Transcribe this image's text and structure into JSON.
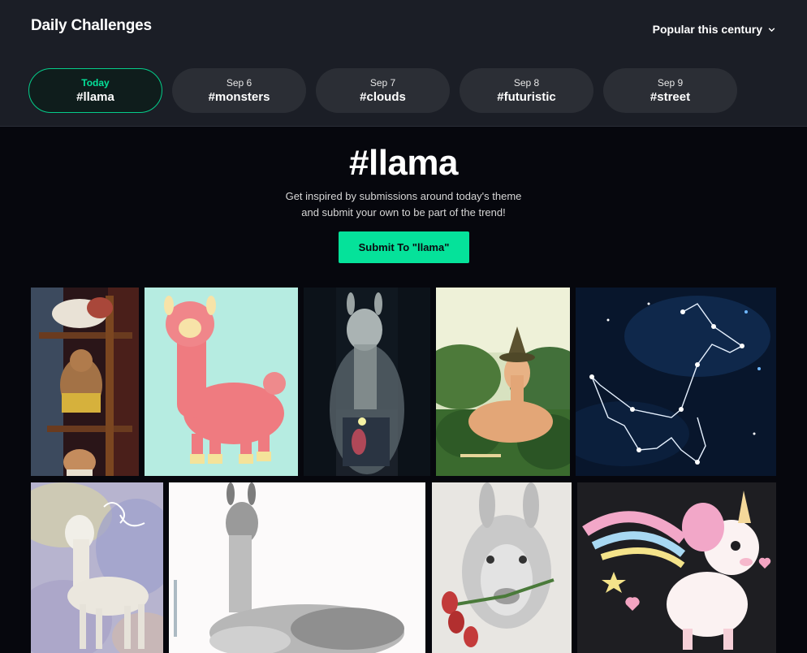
{
  "header": {
    "title": "Daily Challenges",
    "sort_label": "Popular this century",
    "sort_icon": "chevron-down-icon"
  },
  "tabs": [
    {
      "date": "Today",
      "tag": "#llama",
      "active": true
    },
    {
      "date": "Sep 6",
      "tag": "#monsters",
      "active": false
    },
    {
      "date": "Sep 7",
      "tag": "#clouds",
      "active": false
    },
    {
      "date": "Sep 8",
      "tag": "#futuristic",
      "active": false
    },
    {
      "date": "Sep 9",
      "tag": "#street",
      "active": false
    }
  ],
  "hero": {
    "title": "#llama",
    "subtitle_line1": "Get inspired by submissions around today's theme",
    "subtitle_line2": "and submit your own to be part of the trend!",
    "submit_label": "Submit To \"llama\""
  },
  "gallery": [
    {
      "subject": "llamas stacked on shelves"
    },
    {
      "subject": "pink alpaca on mint background"
    },
    {
      "subject": "glowing llama ghost in dark forest"
    },
    {
      "subject": "llama wearing wizard hat in valley"
    },
    {
      "subject": "llama constellation in starry sky"
    },
    {
      "subject": "llama sketch on pastel watercolor"
    },
    {
      "subject": "pencil drawing of resting llama"
    },
    {
      "subject": "llama holding tulips sketch"
    },
    {
      "subject": "rainbow unicorn llama with hearts"
    }
  ],
  "colors": {
    "accent": "#05e29a",
    "topbar_bg": "#1b1e26",
    "page_bg": "#06070d",
    "tab_bg": "#2b2e35"
  }
}
